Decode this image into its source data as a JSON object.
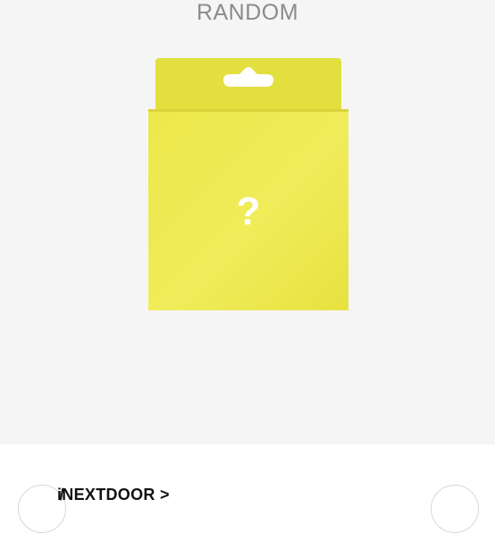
{
  "product": {
    "variant_label": "RANDOM",
    "package_mark": "?",
    "package_color": "#ede84c",
    "package_mark_color": "#ffffff"
  },
  "bottom_bar": {
    "brand_link": "i̸NEXTDOOR >",
    "prev_icon": "chevron-left-icon",
    "next_icon": "chevron-right-icon"
  }
}
